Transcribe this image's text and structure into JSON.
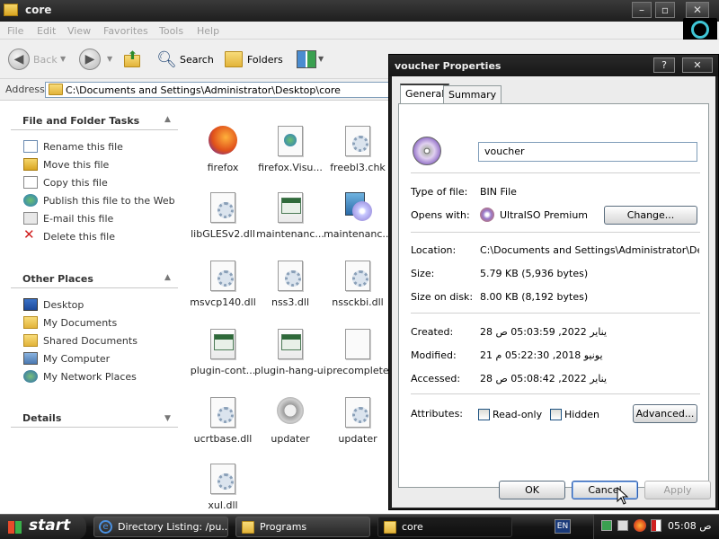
{
  "explorer": {
    "title": "core",
    "menu": [
      "File",
      "Edit",
      "View",
      "Favorites",
      "Tools",
      "Help"
    ],
    "toolbar": {
      "back": "Back",
      "search": "Search",
      "folders": "Folders"
    },
    "address_label": "Address",
    "address_value": "C:\\Documents and Settings\\Administrator\\Desktop\\core",
    "tasks_panel": {
      "file_folder_tasks": {
        "title": "File and Folder Tasks",
        "items": [
          "Rename this file",
          "Move this file",
          "Copy this file",
          "Publish this file to the Web",
          "E-mail this file",
          "Delete this file"
        ]
      },
      "other_places": {
        "title": "Other Places",
        "items": [
          "Desktop",
          "My Documents",
          "Shared Documents",
          "My Computer",
          "My Network Places"
        ]
      },
      "details": {
        "title": "Details"
      }
    },
    "files": [
      {
        "name": "firefox",
        "icon": "firefox-icon"
      },
      {
        "name": "firefox.Visu...",
        "icon": "visual-manifest-icon"
      },
      {
        "name": "freebl3.chk",
        "icon": "settings-file-icon"
      },
      {
        "name": "libGLESv2.dll",
        "icon": "dll-file-icon"
      },
      {
        "name": "maintenanc...",
        "icon": "application-icon"
      },
      {
        "name": "maintenanc...",
        "icon": "installer-icon"
      },
      {
        "name": "msvcp140.dll",
        "icon": "dll-file-icon"
      },
      {
        "name": "nss3.dll",
        "icon": "dll-file-icon"
      },
      {
        "name": "nssckbi.dll",
        "icon": "dll-file-icon"
      },
      {
        "name": "plugin-cont...",
        "icon": "application-icon"
      },
      {
        "name": "plugin-hang-ui",
        "icon": "application-icon"
      },
      {
        "name": "precomplete",
        "icon": "blank-file-icon"
      },
      {
        "name": "ucrtbase.dll",
        "icon": "dll-file-icon"
      },
      {
        "name": "updater",
        "icon": "updater-icon"
      },
      {
        "name": "updater",
        "icon": "settings-file-icon"
      },
      {
        "name": "xul.dll",
        "icon": "dll-file-icon"
      }
    ]
  },
  "properties": {
    "title": "voucher Properties",
    "tabs": [
      "General",
      "Summary"
    ],
    "file_name": "voucher",
    "type_label": "Type of file:",
    "type_value": "BIN File",
    "opens_label": "Opens with:",
    "opens_value": "UltraISO Premium",
    "change_button": "Change...",
    "location_label": "Location:",
    "location_value": "C:\\Documents and Settings\\Administrator\\Desktop\\",
    "size_label": "Size:",
    "size_value": "5.79 KB (5,936 bytes)",
    "size_disk_label": "Size on disk:",
    "size_disk_value": "8.00 KB (8,192 bytes)",
    "created_label": "Created:",
    "created_value": "28 يناير 2022, 05:03:59 ص",
    "modified_label": "Modified:",
    "modified_value": "21 يونيو 2018, 05:22:30 م",
    "accessed_label": "Accessed:",
    "accessed_value": "28 يناير 2022, 05:08:42 ص",
    "attributes_label": "Attributes:",
    "readonly_label": "Read-only",
    "hidden_label": "Hidden",
    "advanced_button": "Advanced...",
    "ok_button": "OK",
    "cancel_button": "Cancel",
    "apply_button": "Apply"
  },
  "taskbar": {
    "start": "start",
    "tasks": [
      "Directory Listing: /pu...",
      "Programs",
      "core"
    ],
    "language": "EN",
    "clock": "05:08 ص"
  },
  "colors": {
    "titlebar": "#1e1e1e",
    "panel_bg": "#ececec",
    "link_text": "#333333"
  }
}
